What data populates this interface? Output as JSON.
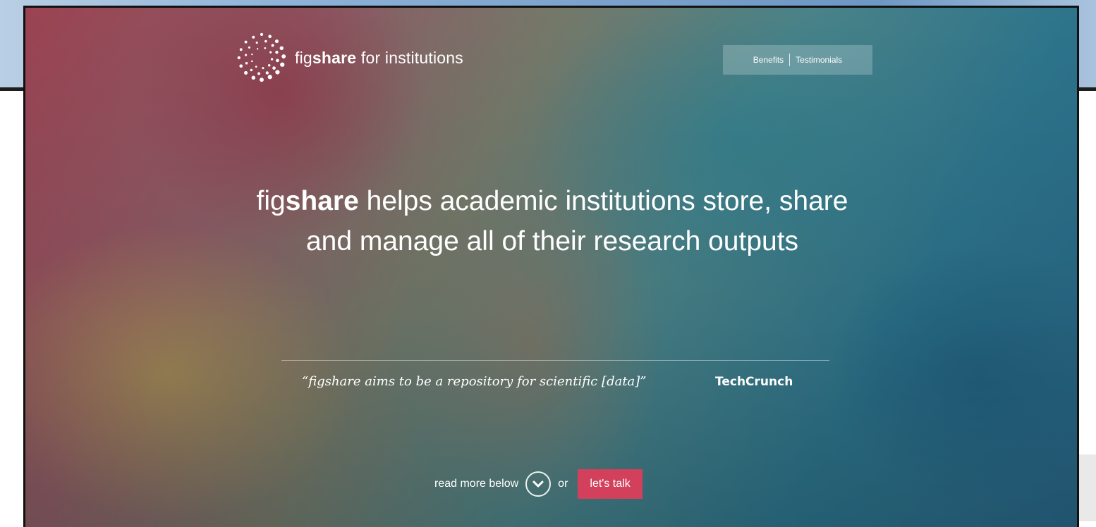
{
  "brand": {
    "name_prefix": "fig",
    "name_bold": "share",
    "name_suffix": " for institutions"
  },
  "nav": {
    "items": [
      {
        "label": "Benefits"
      },
      {
        "label": "Testimonials"
      }
    ]
  },
  "headline": {
    "prefix": "fig",
    "bold": "share",
    "line1_rest": " helps academic institutions store, share",
    "line2": "and manage all of their research outputs"
  },
  "quote": {
    "text": "“figshare aims to be a repository for scientific [data]”",
    "source": "TechCrunch"
  },
  "cta": {
    "read_more": "read more below",
    "or": "or",
    "talk": "let's talk"
  },
  "colors": {
    "accent": "#d2405c",
    "text": "#ffffff"
  }
}
